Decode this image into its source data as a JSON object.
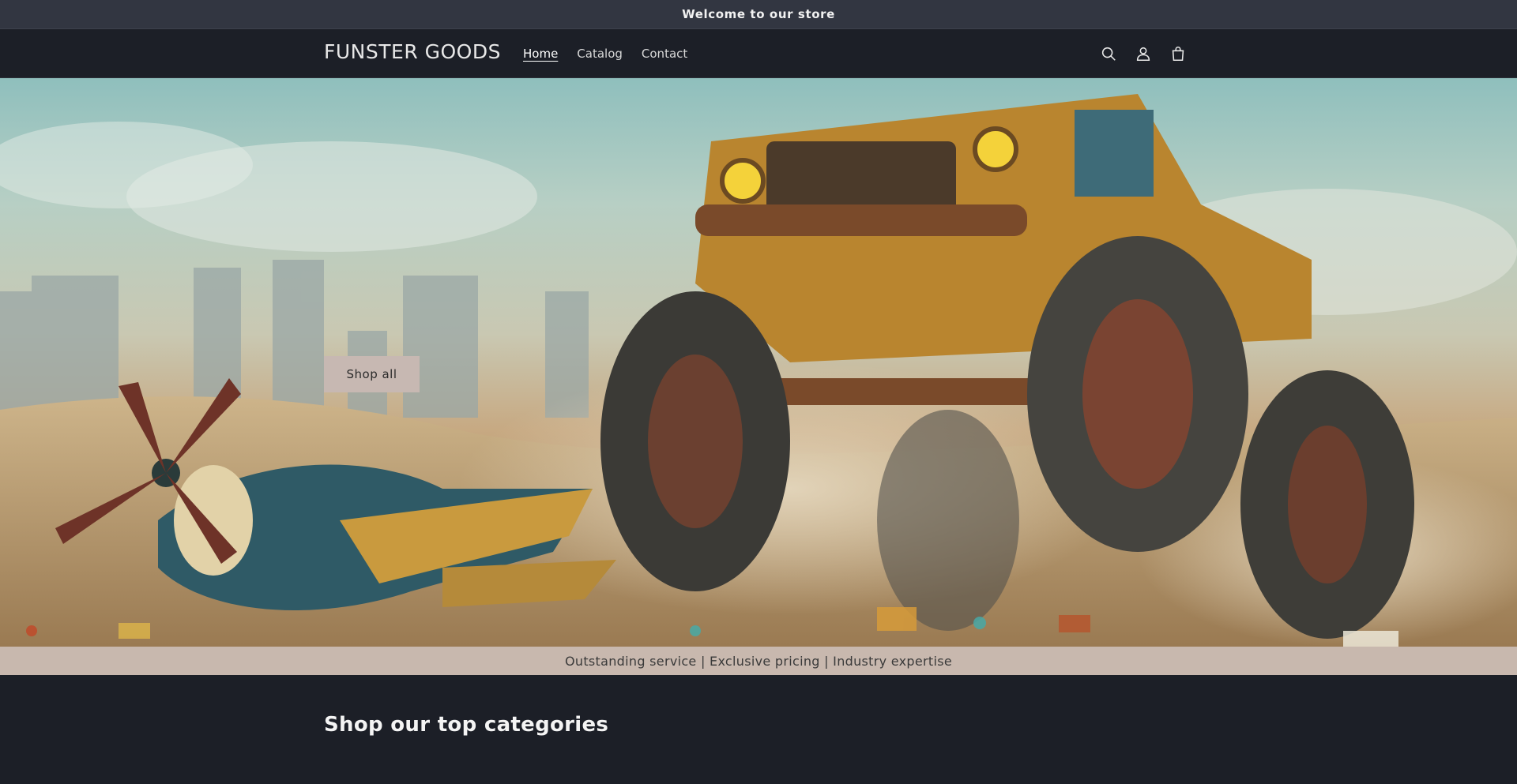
{
  "announcement": {
    "text": "Welcome to our store"
  },
  "header": {
    "logo": "FUNSTER GOODS",
    "nav": [
      {
        "label": "Home",
        "active": true
      },
      {
        "label": "Catalog",
        "active": false
      },
      {
        "label": "Contact",
        "active": false
      }
    ],
    "icons": [
      "search-icon",
      "account-icon",
      "cart-icon"
    ]
  },
  "hero": {
    "button_label": "Shop all",
    "image": "toy monster truck and toy propeller plane in a sandy desert with a city skyline in the background"
  },
  "tagline": {
    "text": "Outstanding service | Exclusive pricing | Industry expertise"
  },
  "categories": {
    "title": "Shop our top categories"
  },
  "colors": {
    "background": "#1c1f27",
    "announcement_bg": "#323641",
    "tagline_bg": "#c8b8ae",
    "button_bg": "#c7b8b2"
  }
}
